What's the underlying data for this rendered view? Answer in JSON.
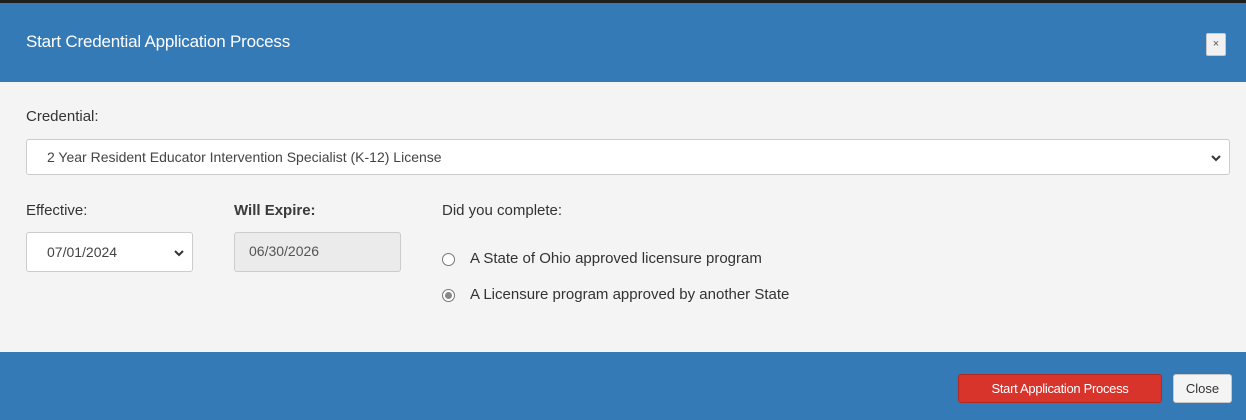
{
  "header": {
    "title": "Start Credential Application Process",
    "close_glyph": "×"
  },
  "form": {
    "credential_label": "Credential:",
    "credential_value": "2 Year Resident Educator Intervention Specialist (K-12) License",
    "effective_label": "Effective:",
    "effective_value": "07/01/2024",
    "expire_label": "Will Expire:",
    "expire_value": "06/30/2026",
    "question": "Did you complete:",
    "options": [
      {
        "label": "A State of Ohio approved licensure program",
        "checked": false
      },
      {
        "label": "A Licensure program approved by another State",
        "checked": true
      }
    ]
  },
  "footer": {
    "start_label": "Start Application Process",
    "close_label": "Close"
  },
  "colors": {
    "header_bg": "#337ab7",
    "body_bg": "#f4f4f4",
    "primary_action": "#d9342b"
  },
  "icons": {
    "close": "close-icon",
    "dropdown": "chevron-down-icon",
    "radio": "radio-icon"
  }
}
